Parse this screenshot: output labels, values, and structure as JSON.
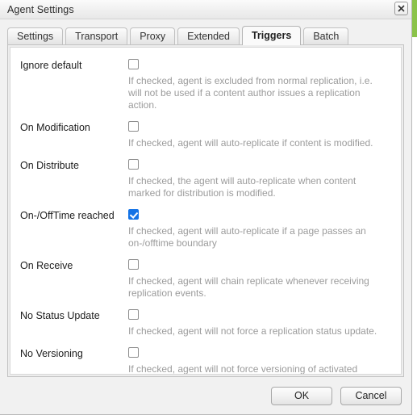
{
  "window": {
    "title": "Agent Settings",
    "close_icon": "close-icon"
  },
  "tabs": [
    {
      "label": "Settings",
      "active": false
    },
    {
      "label": "Transport",
      "active": false
    },
    {
      "label": "Proxy",
      "active": false
    },
    {
      "label": "Extended",
      "active": false
    },
    {
      "label": "Triggers",
      "active": true
    },
    {
      "label": "Batch",
      "active": false
    }
  ],
  "colors": {
    "checkbox_checked": "#1473e6",
    "accent_stripe": "#8bc34a",
    "description_text": "#9b9b9b",
    "dialog_background": "#f1f1f1",
    "panel_background": "#ffffff"
  },
  "settings": [
    {
      "label": "Ignore default",
      "checked": false,
      "description": "If checked, agent is excluded from normal replication, i.e. will not be used if a content author issues a replication action."
    },
    {
      "label": "On Modification",
      "checked": false,
      "description": "If checked, agent will auto-replicate if content is modified."
    },
    {
      "label": "On Distribute",
      "checked": false,
      "description": "If checked, the agent will auto-replicate when content marked for distribution is modified."
    },
    {
      "label": "On-/OffTime reached",
      "checked": true,
      "description": "If checked, agent will auto-replicate if a page passes an on-/offtime boundary"
    },
    {
      "label": "On Receive",
      "checked": false,
      "description": "If checked, agent will chain replicate whenever receiving replication events."
    },
    {
      "label": "No Status Update",
      "checked": false,
      "description": "If checked, agent will not force a replication status update."
    },
    {
      "label": "No Versioning",
      "checked": false,
      "description": "If checked, agent will not force versioning of activated pages."
    }
  ],
  "footer": {
    "ok_label": "OK",
    "cancel_label": "Cancel"
  }
}
